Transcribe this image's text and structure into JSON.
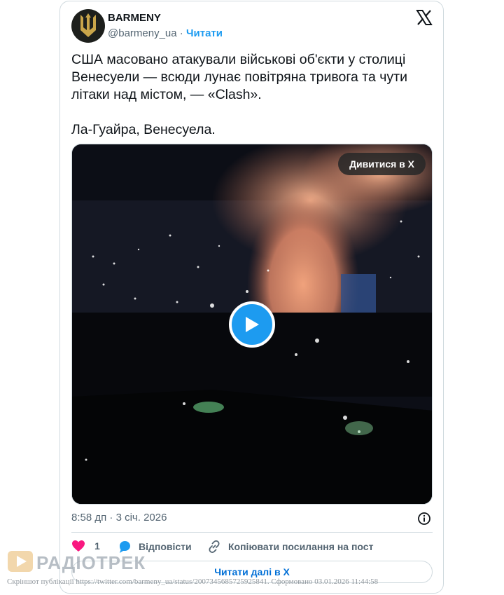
{
  "author": {
    "name": "BARMENY",
    "handle": "@barmeny_ua",
    "separator": "·",
    "follow_label": "Читати"
  },
  "tweet": {
    "text": "США масовано атакували військові об'єкти у столиці Венесуели — всюди лунає повітряна тривога та чути літаки над містом, — «Clash».\n\nЛа-Гуайра, Венесуела."
  },
  "media": {
    "watch_label": "Дивитися в X"
  },
  "meta": {
    "time": "8:58 дп",
    "dot": "·",
    "date": "3 січ. 2026"
  },
  "actions": {
    "likes": "1",
    "reply_label": "Відповісти",
    "copy_label": "Копіювати посилання на пост"
  },
  "read_more_label": "Читати далі в X",
  "watermark": {
    "brand": "РАДІОТРЕК",
    "caption": "Скріншот публікації https://twitter.com/barmeny_ua/status/2007345685725925841. Сформовано 03.01.2026 11:44:58"
  },
  "colors": {
    "accent": "#1d9bf0",
    "like": "#f91880",
    "link": "#006fd6",
    "muted": "#536471"
  }
}
